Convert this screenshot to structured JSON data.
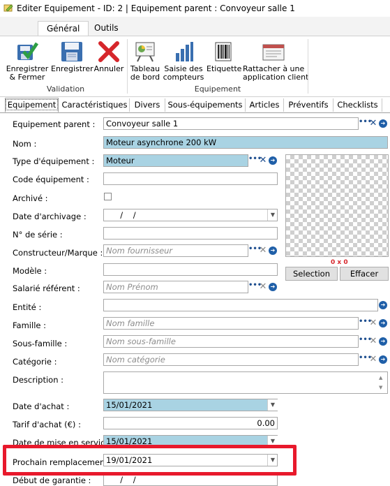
{
  "window": {
    "title": "Editer Equipement - ID: 2  | Equipement parent : Convoyeur salle 1"
  },
  "ribbon": {
    "tabs": [
      "Général",
      "Outils"
    ],
    "validation": {
      "group_label": "Validation",
      "save_close": "Enregistrer\n& Fermer",
      "save": "Enregistrer",
      "cancel": "Annuler"
    },
    "equipement": {
      "group_label": "Equipement",
      "dashboard": "Tableau\nde bord",
      "counters": "Saisie des\ncompteurs",
      "label": "Etiquette",
      "attach": "Rattacher à une\napplication client"
    },
    "colors": {
      "save_green": "#2e9e44",
      "disk_blue": "#3a6fb0",
      "cancel_red": "#d6262b"
    }
  },
  "tabs": [
    "Equipement",
    "Caractéristiques",
    "Divers",
    "Sous-équipements",
    "Articles",
    "Préventifs",
    "Checklists"
  ],
  "form": {
    "equipement_parent": {
      "label": "Equipement parent :",
      "value": "Convoyeur salle 1"
    },
    "nom": {
      "label": "Nom :",
      "value": "Moteur asynchrone 200 kW"
    },
    "type_equipement": {
      "label": "Type d'équipement :",
      "value": "Moteur"
    },
    "code_equipement": {
      "label": "Code équipement :",
      "value": ""
    },
    "archive": {
      "label": "Archivé :",
      "checked": false
    },
    "date_archivage": {
      "label": "Date d'archivage :",
      "value": "  /    /"
    },
    "numero_serie": {
      "label": "N° de série :",
      "value": ""
    },
    "constructeur": {
      "label": "Constructeur/Marque :",
      "placeholder": "Nom fournisseur"
    },
    "modele": {
      "label": "Modèle :",
      "value": ""
    },
    "salarie_referent": {
      "label": "Salarié référent :",
      "placeholder": "Nom Prénom"
    },
    "entite": {
      "label": "Entité :",
      "value": ""
    },
    "famille": {
      "label": "Famille :",
      "placeholder": "Nom famille"
    },
    "sous_famille": {
      "label": "Sous-famille :",
      "placeholder": "Nom sous-famille"
    },
    "categorie": {
      "label": "Catégorie :",
      "placeholder": "Nom catégorie"
    },
    "description": {
      "label": "Description :",
      "value": ""
    },
    "date_achat": {
      "label": "Date d'achat :",
      "value": "15/01/2021"
    },
    "tarif_achat": {
      "label": "Tarif d'achat (€) :",
      "value": "0.00"
    },
    "date_mise_service": {
      "label": "Date de mise en service :",
      "value": "15/01/2021"
    },
    "prochain_remplacement": {
      "label": "Prochain remplacement :",
      "value": "19/01/2021"
    },
    "debut_garantie": {
      "label": "Début de garantie :",
      "value": "  /    /"
    }
  },
  "photo": {
    "size_text": "0 x 0",
    "select_button": "Selection",
    "clear_button": "Effacer"
  },
  "highlight_color": "#e8192c"
}
